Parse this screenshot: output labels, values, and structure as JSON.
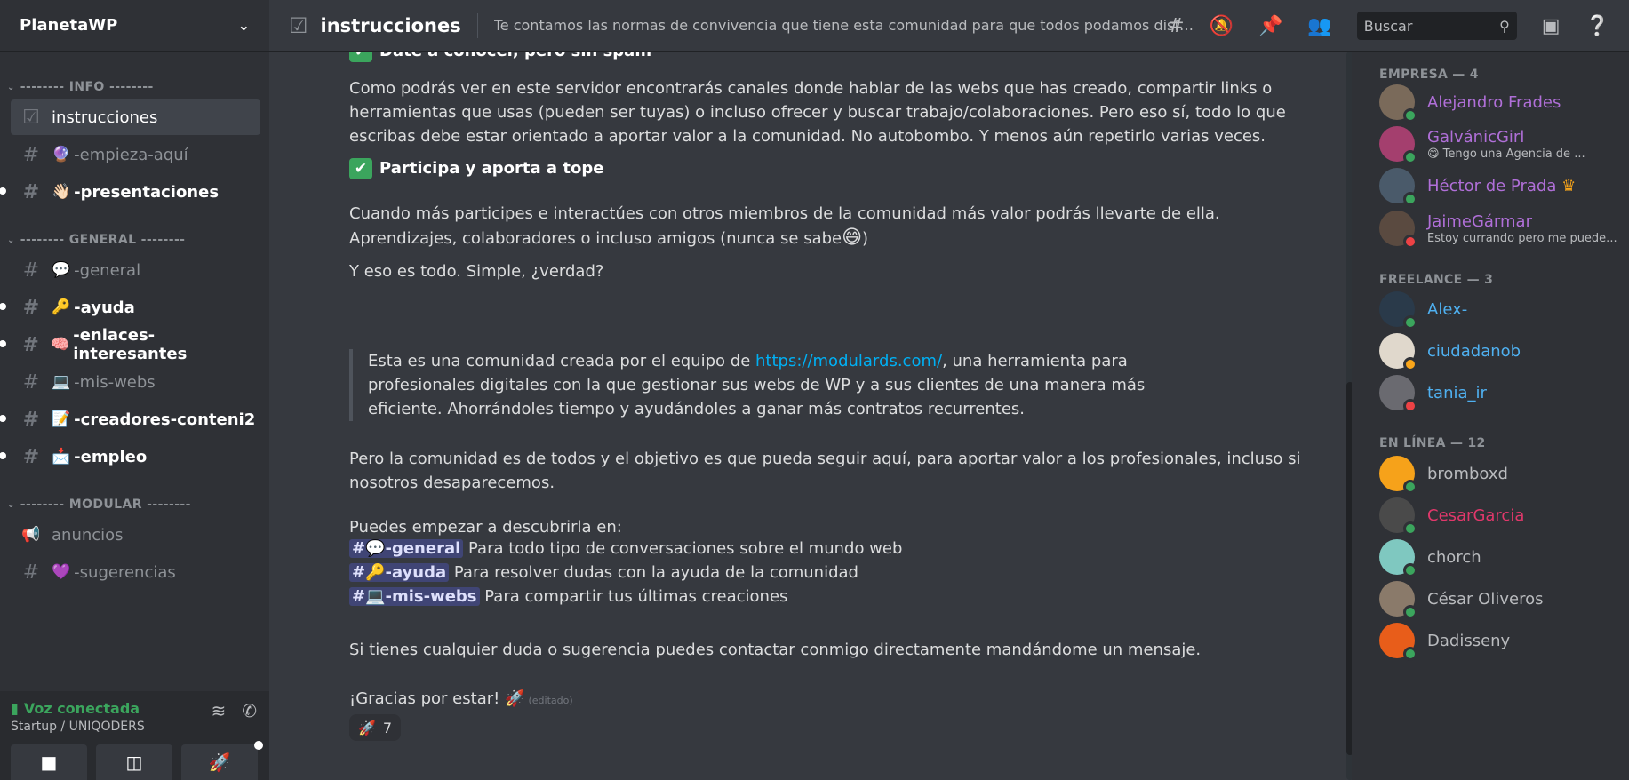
{
  "server": {
    "name": "PlanetaWP"
  },
  "sidebar": {
    "categories": [
      {
        "name": "-------- INFO --------",
        "channels": [
          {
            "icon": "checklist-icon",
            "emoji": "",
            "name": "instrucciones",
            "state": "active"
          },
          {
            "icon": "#",
            "emoji": "🔮",
            "name": "-empieza-aquí",
            "state": "muted"
          },
          {
            "icon": "#",
            "emoji": "👋🏻",
            "name": "-presentaciones",
            "state": "unread"
          }
        ]
      },
      {
        "name": "-------- GENERAL --------",
        "channels": [
          {
            "icon": "#",
            "emoji": "💬",
            "name": "-general",
            "state": "muted"
          },
          {
            "icon": "#",
            "emoji": "🔑",
            "name": "-ayuda",
            "state": "unread"
          },
          {
            "icon": "#",
            "emoji": "🧠",
            "name": "-enlaces-interesantes",
            "state": "unread"
          },
          {
            "icon": "#",
            "emoji": "💻",
            "name": "-mis-webs",
            "state": "muted"
          },
          {
            "icon": "#",
            "emoji": "📝",
            "name": "-creadores-conteni2",
            "state": "unread"
          },
          {
            "icon": "#",
            "emoji": "📩",
            "name": "-empleo",
            "state": "unread"
          }
        ]
      },
      {
        "name": "-------- MODULAR --------",
        "channels": [
          {
            "icon": "megaphone-icon",
            "emoji": "",
            "name": "anuncios",
            "state": "muted"
          },
          {
            "icon": "#",
            "emoji": "💜",
            "name": "-sugerencias",
            "state": "muted"
          }
        ]
      }
    ],
    "voice": {
      "status": "Voz conectada",
      "location": "Startup / UNIQODERS"
    }
  },
  "header": {
    "channel": "instrucciones",
    "topic": "Te contamos las normas de convivencia que tiene esta comunidad para que todos podamos disfrutar de el...",
    "search_placeholder": "Buscar"
  },
  "message": {
    "heading_top": "Date a conocer, pero sin spam",
    "p1": "Como podrás ver en este servidor encontrarás canales donde hablar de las webs que has creado, compartir links o herramientas que usas (pueden ser tuyas) o incluso ofrecer y buscar trabajo/colaboraciones. Pero eso sí, todo lo que escribas debe estar orientado a aportar valor a la comunidad. No autobombo. Y menos aún repetirlo varias veces.",
    "heading2": "Participa y aporta a tope",
    "p2a": "Cuando más participes e interactúes con otros miembros de la comunidad más valor podrás llevarte de ella. Aprendizajes, colaboradores o incluso amigos (nunca se sabe",
    "p2b": ")",
    "p3": "Y eso es todo. Simple, ¿verdad?",
    "quote_a": "Esta es una comunidad creada por el equipo de ",
    "quote_link": "https://modulards.com/",
    "quote_b": ", una herramienta para profesionales digitales con la que gestionar sus webs de WP y a sus clientes de una manera más eficiente. Ahorrándoles tiempo y ayudándoles a ganar más contratos recurrentes.",
    "p4": "Pero la comunidad es de todos y el objetivo es que pueda seguir aquí, para aportar valor a los profesionales, incluso si nosotros desaparecemos.",
    "p5": "Puedes empezar a descubrirla en:",
    "links": [
      {
        "mention": "#💬-general",
        "desc": " Para todo tipo de conversaciones sobre el mundo web"
      },
      {
        "mention": "#🔑-ayuda",
        "desc": " Para resolver dudas con la ayuda de la comunidad"
      },
      {
        "mention": "#💻-mis-webs",
        "desc": " Para compartir tus últimas creaciones"
      }
    ],
    "p6": "Si tienes cualquier duda o sugerencia puedes contactar conmigo directamente mandándome un mensaje.",
    "p7": "¡Gracias por estar! 🚀",
    "edited": "(editado)",
    "reaction": {
      "emoji": "🚀",
      "count": "7"
    }
  },
  "members": {
    "groups": [
      {
        "title": "EMPRESA — 4"
      },
      {
        "title": "FREELANCE — 3"
      },
      {
        "title": "EN LÍNEA — 12"
      }
    ],
    "list": [
      {
        "name": "Alejandro Frades",
        "sub": "",
        "color": "#b06fd8",
        "avatar": "#7a6a5a",
        "status": "#3ba55d"
      },
      {
        "name": "GalvánicGirl",
        "sub": "😋 Tengo una Agencia de ...",
        "color": "#b06fd8",
        "avatar": "#a43f6e",
        "status": "#3ba55d"
      },
      {
        "name": "Héctor de Prada",
        "sub": "",
        "color": "#b06fd8",
        "avatar": "#4a5a6a",
        "status": "#3ba55d",
        "crown": "♛"
      },
      {
        "name": "JaimeGármar",
        "sub": "Estoy currando pero me puede...",
        "color": "#b06fd8",
        "avatar": "#5a4a40",
        "status": "#ed4245"
      },
      {
        "name": "Alex-",
        "sub": "",
        "color": "#4fb0f0",
        "avatar": "#2a3a4a",
        "status": "#3ba55d"
      },
      {
        "name": "ciudadanob",
        "sub": "",
        "color": "#4fb0f0",
        "avatar": "#e0d8cc",
        "status": "#faa61a"
      },
      {
        "name": "tania_ir",
        "sub": "",
        "color": "#4fb0f0",
        "avatar": "#6a6a70",
        "status": "#ed4245"
      },
      {
        "name": "bromboxd",
        "sub": "",
        "color": "#b9bbbe",
        "avatar": "#f6a21a",
        "status": "#3ba55d"
      },
      {
        "name": "CesarGarcia",
        "sub": "",
        "color": "#e0386b",
        "avatar": "#4a4a4a",
        "status": "#3ba55d"
      },
      {
        "name": "chorch",
        "sub": "",
        "color": "#b9bbbe",
        "avatar": "#7fc8c0",
        "status": "#3ba55d"
      },
      {
        "name": "César Oliveros",
        "sub": "",
        "color": "#b9bbbe",
        "avatar": "#8a7a6a",
        "status": "#3ba55d"
      },
      {
        "name": "Dadisseny",
        "sub": "",
        "color": "#b9bbbe",
        "avatar": "#e85d1a",
        "status": "#3ba55d"
      }
    ]
  }
}
